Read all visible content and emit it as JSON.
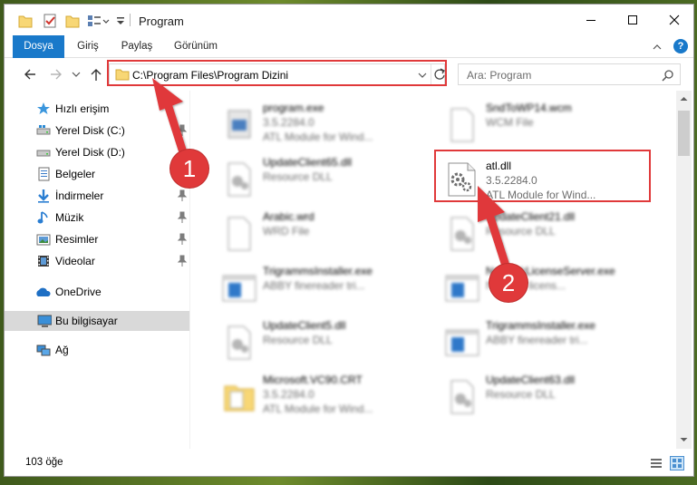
{
  "window": {
    "title": "Program",
    "controls": {
      "minimize": "—",
      "maximize": "☐",
      "close": "✕"
    }
  },
  "ribbon": {
    "tabs": [
      "Dosya",
      "Giriş",
      "Paylaş",
      "Görünüm"
    ]
  },
  "address": {
    "path": "C:\\Program Files\\Program Dizini"
  },
  "search": {
    "placeholder": "Ara: Program"
  },
  "sidebar": {
    "items": [
      {
        "label": "Hızlı erişim",
        "icon": "star-icon"
      },
      {
        "label": "Yerel Disk (C:)",
        "icon": "drive-icon"
      },
      {
        "label": "Yerel Disk (D:)",
        "icon": "drive-icon"
      },
      {
        "label": "Belgeler",
        "icon": "documents-icon"
      },
      {
        "label": "İndirmeler",
        "icon": "download-icon"
      },
      {
        "label": "Müzik",
        "icon": "music-icon"
      },
      {
        "label": "Resimler",
        "icon": "pictures-icon"
      },
      {
        "label": "Videolar",
        "icon": "video-icon"
      },
      {
        "label": "OneDrive",
        "icon": "cloud-icon"
      },
      {
        "label": "Bu bilgisayar",
        "icon": "computer-icon"
      },
      {
        "label": "Ağ",
        "icon": "network-icon"
      }
    ]
  },
  "files": [
    {
      "name": "program.exe",
      "line2": "3.5.2284.0",
      "line3": "ATL Module for Wind..."
    },
    {
      "name": "SndToWP14.wcm",
      "line2": "WCM File",
      "line3": ""
    },
    {
      "name": "UpdateClient65.dll",
      "line2": "Resource DLL",
      "line3": ""
    },
    {
      "name": "atl.dll",
      "line2": "3.5.2284.0",
      "line3": "ATL Module for Wind..."
    },
    {
      "name": "Arabic.wrd",
      "line2": "WRD File",
      "line3": ""
    },
    {
      "name": "UpdateClient21.dll",
      "line2": "Resource DLL",
      "line3": ""
    },
    {
      "name": "TrigrammsInstaller.exe",
      "line2": "ABBY finereader tri...",
      "line3": ""
    },
    {
      "name": "NetworkLicenseServer.exe",
      "line2": "Network licens...",
      "line3": ""
    },
    {
      "name": "UpdateClient5.dll",
      "line2": "Resource DLL",
      "line3": ""
    },
    {
      "name": "TrigrammsInstaller.exe",
      "line2": "ABBY finereader tri...",
      "line3": ""
    },
    {
      "name": "Microsoft.VC90.CRT",
      "line2": "3.5.2284.0",
      "line3": "ATL Module for Wind..."
    },
    {
      "name": "UpdateClient63.dll",
      "line2": "Resource DLL",
      "line3": ""
    }
  ],
  "status": {
    "item_count": "103 öğe"
  },
  "annotations": {
    "callout1": "1",
    "callout2": "2",
    "color": "#e0393a"
  },
  "colors": {
    "file_tab": "#1979ca",
    "selected_nav": "#d9d9d9"
  }
}
